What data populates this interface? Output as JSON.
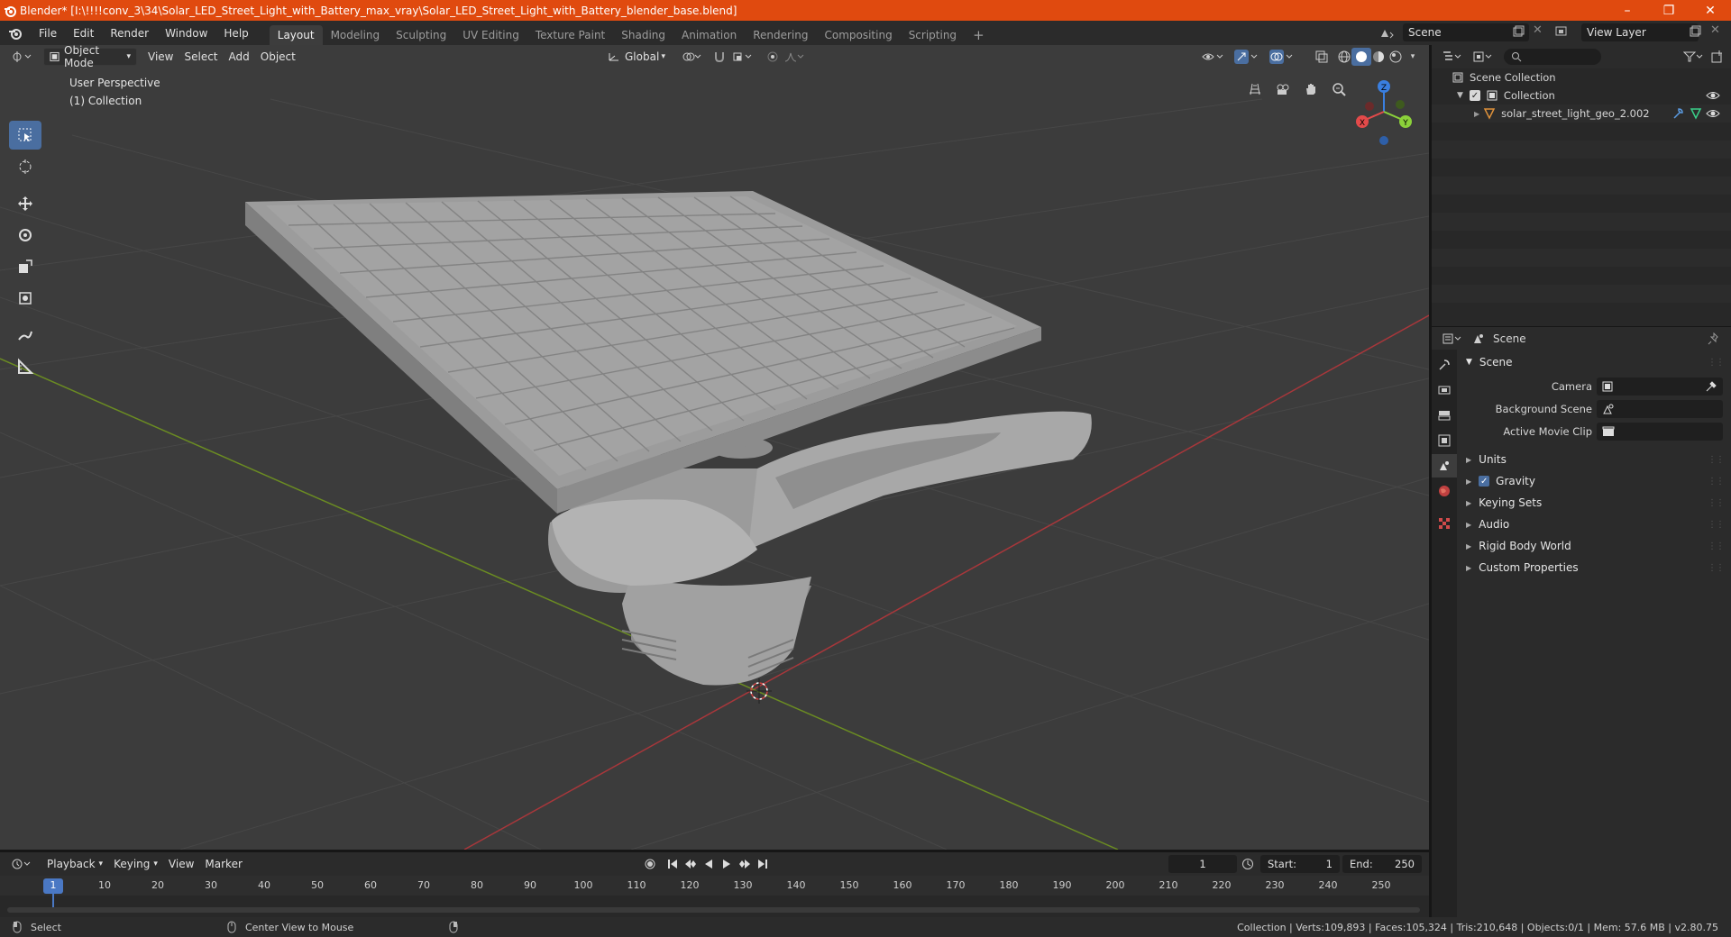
{
  "titlebar": {
    "title": "Blender* [I:\\!!!!conv_3\\34\\Solar_LED_Street_Light_with_Battery_max_vray\\Solar_LED_Street_Light_with_Battery_blender_base.blend]",
    "minimize": "–",
    "maximize": "❐",
    "close": "✕"
  },
  "menu": {
    "items": [
      "File",
      "Edit",
      "Render",
      "Window",
      "Help"
    ]
  },
  "workspaces": [
    "Layout",
    "Modeling",
    "Sculpting",
    "UV Editing",
    "Texture Paint",
    "Shading",
    "Animation",
    "Rendering",
    "Compositing",
    "Scripting"
  ],
  "add_workspace": "+",
  "scene_selector": "Scene",
  "view_layer_selector": "View Layer",
  "viewport": {
    "mode": "Object Mode",
    "menus": [
      "View",
      "Select",
      "Add",
      "Object"
    ],
    "orientation": "Global",
    "overlay_title": "User Perspective",
    "overlay_collection": "(1) Collection",
    "gizmo": {
      "x": "X",
      "y": "Y",
      "z": "Z"
    }
  },
  "outliner": {
    "search_placeholder": "",
    "root": "Scene Collection",
    "collection": "Collection",
    "object": "solar_street_light_geo_2.002"
  },
  "properties": {
    "header_title": "Scene",
    "panel_title": "Scene",
    "camera_label": "Camera",
    "background_scene_label": "Background Scene",
    "active_movie_clip_label": "Active Movie Clip",
    "subpanels": [
      "Units",
      "Gravity",
      "Keying Sets",
      "Audio",
      "Rigid Body World",
      "Custom Properties"
    ],
    "gravity_checked": true
  },
  "timeline": {
    "menus": [
      "Playback",
      "Keying",
      "View",
      "Marker"
    ],
    "current_frame": "1",
    "start_label": "Start:",
    "start_value": "1",
    "end_label": "End:",
    "end_value": "250",
    "ticks": [
      "1",
      "10",
      "20",
      "30",
      "40",
      "50",
      "60",
      "70",
      "80",
      "90",
      "100",
      "110",
      "120",
      "130",
      "140",
      "150",
      "160",
      "170",
      "180",
      "190",
      "200",
      "210",
      "220",
      "230",
      "240",
      "250"
    ]
  },
  "statusbar": {
    "select": "Select",
    "center_view": "Center View to Mouse",
    "stats": "Collection | Verts:109,893 | Faces:105,324 | Tris:210,648 | Objects:0/1 | Mem: 57.6 MB | v2.80.75"
  },
  "colors": {
    "titlebar": "#e04a0f",
    "accent": "#4a6ea0",
    "axis_x": "#e34a4a",
    "axis_y": "#8bd13a",
    "axis_z": "#3a7fe0"
  }
}
